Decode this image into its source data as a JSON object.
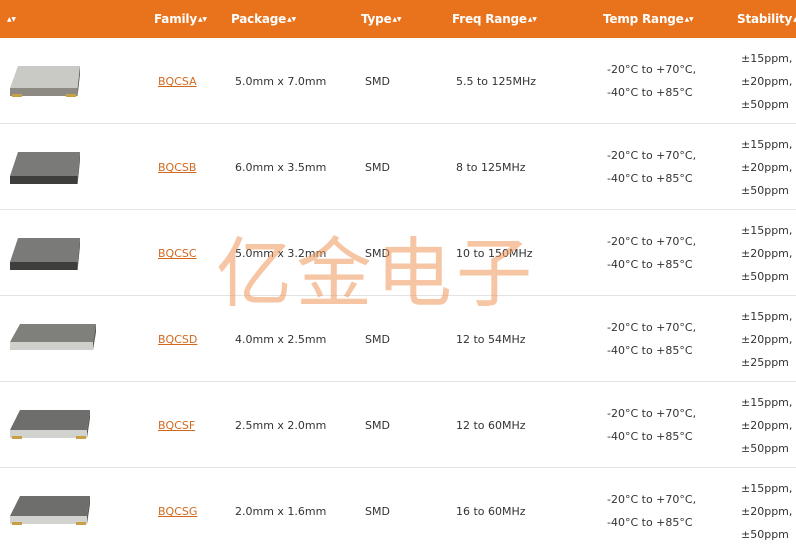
{
  "header": {
    "columns": [
      {
        "key": "image",
        "label": ""
      },
      {
        "key": "family",
        "label": "Family"
      },
      {
        "key": "package",
        "label": "Package"
      },
      {
        "key": "type",
        "label": "Type"
      },
      {
        "key": "freq",
        "label": "Freq Range"
      },
      {
        "key": "temp",
        "label": "Temp Range"
      },
      {
        "key": "stability",
        "label": "Stability"
      }
    ],
    "sort_icon": "sort-arrows-icon"
  },
  "rows": [
    {
      "family": "BQCSA",
      "package": "5.0mm x 7.0mm",
      "type": "SMD",
      "freq": "5.5 to 125MHz",
      "temp": [
        "-20°C to +70°C,",
        "-40°C to +85°C"
      ],
      "stability": [
        "±15ppm,",
        "±20ppm,",
        "±50ppm"
      ]
    },
    {
      "family": "BQCSB",
      "package": "6.0mm x 3.5mm",
      "type": "SMD",
      "freq": "8 to 125MHz",
      "temp": [
        "-20°C to +70°C,",
        "-40°C to +85°C"
      ],
      "stability": [
        "±15ppm,",
        "±20ppm,",
        "±50ppm"
      ]
    },
    {
      "family": "BQCSC",
      "package": "5.0mm x 3.2mm",
      "type": "SMD",
      "freq": "10 to 150MHz",
      "temp": [
        "-20°C to +70°C,",
        "-40°C to +85°C"
      ],
      "stability": [
        "±15ppm,",
        "±20ppm,",
        "±50ppm"
      ]
    },
    {
      "family": "BQCSD",
      "package": "4.0mm x 2.5mm",
      "type": "SMD",
      "freq": "12 to 54MHz",
      "temp": [
        "-20°C to +70°C,",
        "-40°C to +85°C"
      ],
      "stability": [
        "±15ppm,",
        "±20ppm,",
        "±25ppm"
      ]
    },
    {
      "family": "BQCSF",
      "package": "2.5mm x 2.0mm",
      "type": "SMD",
      "freq": "12 to 60MHz",
      "temp": [
        "-20°C to +70°C,",
        "-40°C to +85°C"
      ],
      "stability": [
        "±15ppm,",
        "±20ppm,",
        "±50ppm"
      ]
    },
    {
      "family": "BQCSG",
      "package": "2.0mm x 1.6mm",
      "type": "SMD",
      "freq": "16 to 60MHz",
      "temp": [
        "-20°C to +70°C,",
        "-40°C to +85°C"
      ],
      "stability": [
        "±15ppm,",
        "±20ppm,",
        "±50ppm"
      ]
    }
  ],
  "watermark": "亿金电子",
  "colors": {
    "header_bg": "#e8731c",
    "link": "#d2691e",
    "watermark": "#ee965a"
  }
}
